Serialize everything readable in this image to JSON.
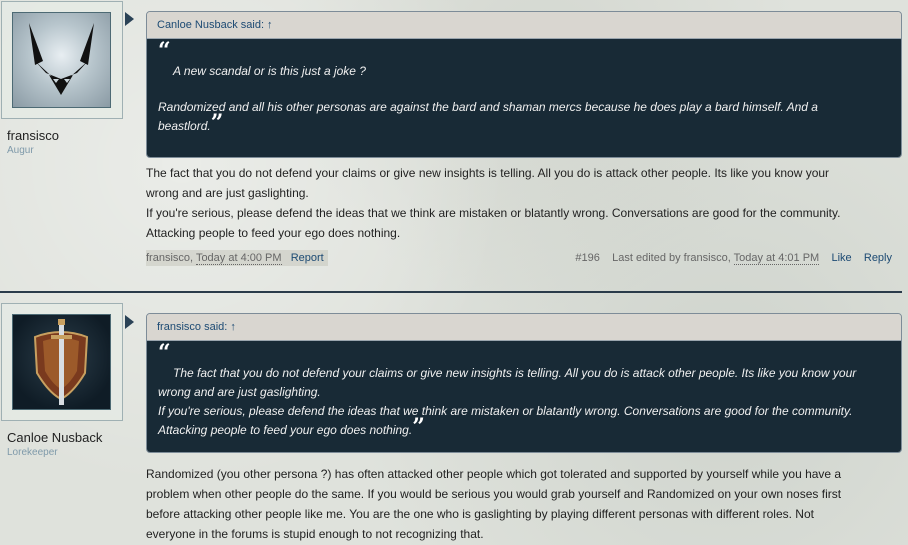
{
  "posts": [
    {
      "user": {
        "name": "fransisco",
        "title": "Augur",
        "avatar_icon": "fox-mask-avatar"
      },
      "quote": {
        "attribution": "Canloe Nusback said: ↑",
        "lines": [
          "A new scandal or is this just a joke ?",
          "",
          "Randomized and all his other personas are against the bard and shaman mercs because he does play a bard himself. And a",
          "beastlord."
        ]
      },
      "message": [
        "The fact that you do not defend your claims or give new insights is telling. All you do is attack other people. Its like you know your",
        "wrong and are just gaslighting.",
        "If you're serious, please defend the ideas that we think are mistaken or blatantly wrong. Conversations are good for the community.",
        "Attacking people to feed your ego does nothing."
      ],
      "meta": {
        "author": "fransisco,",
        "time": "Today at 4:00 PM",
        "report": "Report",
        "post_number": "#196",
        "edited_prefix": "Last edited by fransisco,",
        "edited_time": "Today at 4:01 PM",
        "like": "Like",
        "reply": "Reply"
      }
    },
    {
      "user": {
        "name": "Canloe Nusback",
        "title": "Lorekeeper",
        "avatar_icon": "shield-sword-avatar"
      },
      "quote": {
        "attribution": "fransisco said: ↑",
        "lines": [
          "The fact that you do not defend your claims or give new insights is telling. All you do is attack other people. Its like you know your",
          "wrong and are just gaslighting.",
          "If you're serious, please defend the ideas that we think are mistaken or blatantly wrong. Conversations are good for the community.",
          "Attacking people to feed your ego does nothing."
        ]
      },
      "message": [
        "Randomized (you other persona ?) has often attacked other people which got tolerated and supported by yourself while you have a",
        "problem when other people do the same. If you would be serious you would grab yourself and Randomized on your own noses first",
        "before attacking other people like me. You are the one who is gaslighting by playing different personas with different roles. Not",
        "everyone in the forums is stupid enough to not recognizing that."
      ]
    }
  ],
  "colors": {
    "quote_bg": "#182a36",
    "quote_head_bg": "#d9d6d0",
    "link": "#1c4a73",
    "separator": "#2a3b4a"
  }
}
